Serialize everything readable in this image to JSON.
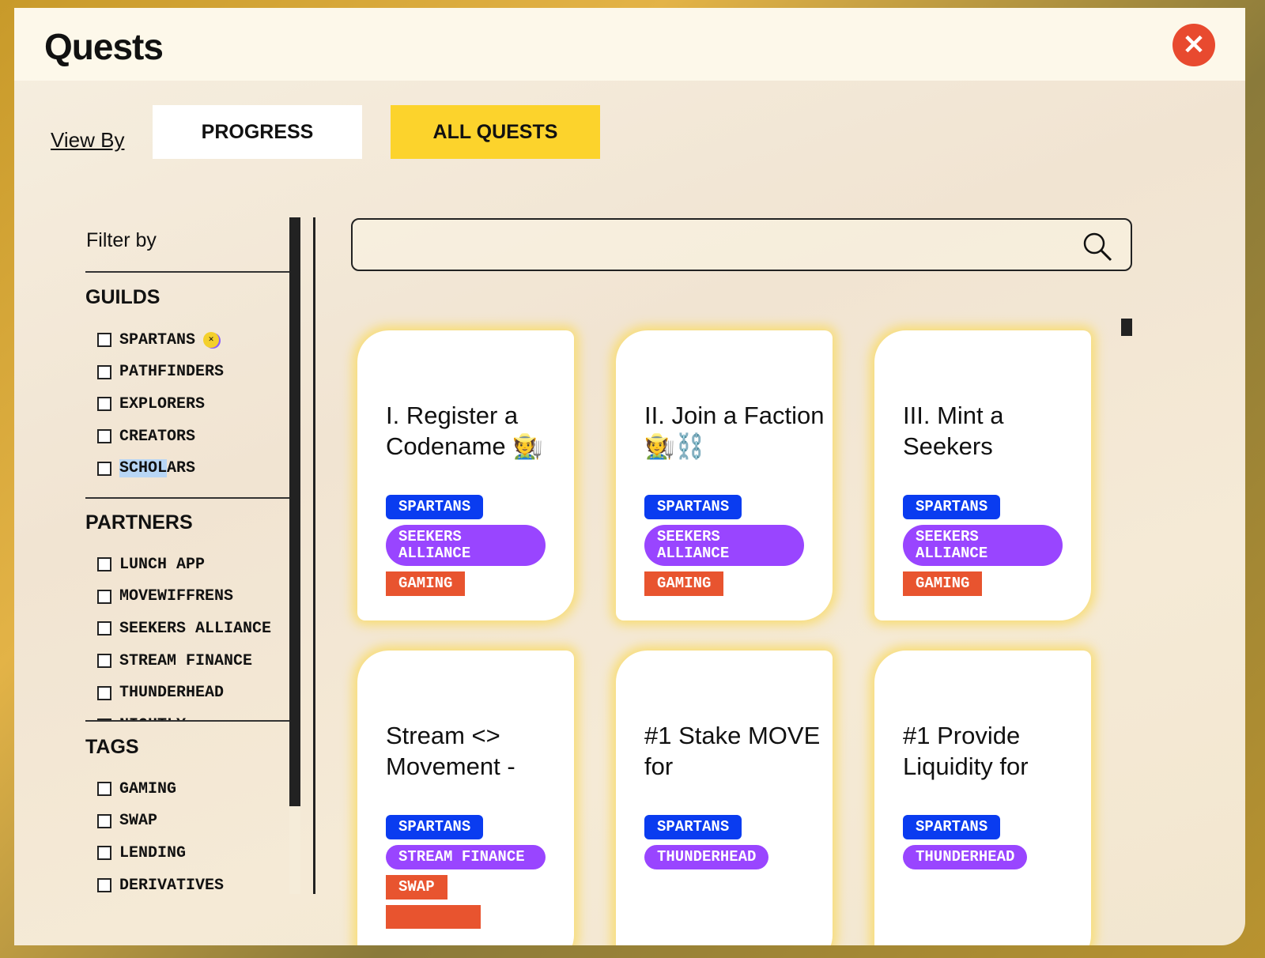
{
  "header": {
    "title": "Quests",
    "close_icon": "close-icon",
    "close_color": "#e84a2f"
  },
  "view_by": {
    "label": "View By",
    "tabs": [
      {
        "label": "PROGRESS",
        "active": false
      },
      {
        "label": "ALL QUESTS",
        "active": true
      }
    ],
    "active_color": "#fcd32c"
  },
  "filters": {
    "title": "Filter by",
    "guilds": {
      "title": "GUILDS",
      "items": [
        "SPARTANS",
        "PATHFINDERS",
        "EXPLORERS",
        "CREATORS",
        "SCHOLARS"
      ]
    },
    "partners": {
      "title": "PARTNERS",
      "items": [
        "LUNCH APP",
        "MOVEWIFFRENS",
        "SEEKERS ALLIANCE",
        "STREAM FINANCE",
        "THUNDERHEAD",
        "NIGHTLY"
      ]
    },
    "tags": {
      "title": "TAGS",
      "items": [
        "GAMING",
        "SWAP",
        "LENDING",
        "DERIVATIVES"
      ]
    }
  },
  "search": {
    "placeholder": "",
    "value": ""
  },
  "quests": [
    {
      "title": "I. Register a Codename 🧑‍🌾",
      "guild": "SPARTANS",
      "partner": "SEEKERS ALLIANCE",
      "tags": [
        "GAMING"
      ]
    },
    {
      "title": "II. Join a Faction 🧑‍🌾⛓️",
      "guild": "SPARTANS",
      "partner": "SEEKERS ALLIANCE",
      "tags": [
        "GAMING"
      ]
    },
    {
      "title": "III. Mint a Seekers",
      "guild": "SPARTANS",
      "partner": "SEEKERS ALLIANCE",
      "tags": [
        "GAMING"
      ]
    },
    {
      "title": "Stream <> Movement -",
      "guild": "SPARTANS",
      "partner": "STREAM FINANCE",
      "tags": [
        "SWAP",
        ""
      ]
    },
    {
      "title": "#1 Stake MOVE for",
      "guild": "SPARTANS",
      "partner": "THUNDERHEAD",
      "tags": []
    },
    {
      "title": "#1 Provide Liquidity for",
      "guild": "SPARTANS",
      "partner": "THUNDERHEAD",
      "tags": []
    }
  ],
  "colors": {
    "guild_tag": "#0a3cf0",
    "partner_tag": "#9945ff",
    "category_tag": "#e8542f"
  }
}
